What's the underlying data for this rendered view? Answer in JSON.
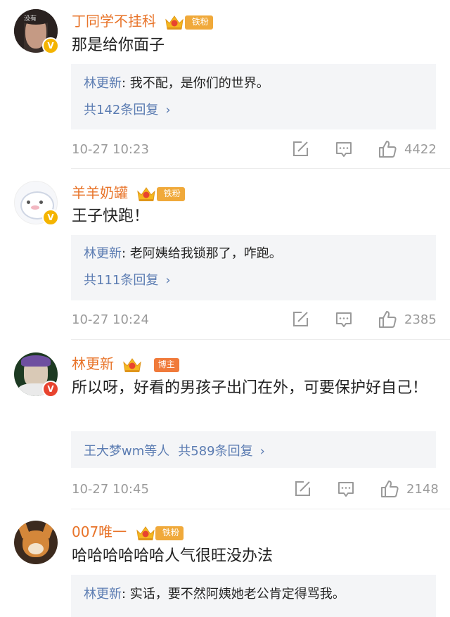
{
  "comments": [
    {
      "user": "丁同学不挂科",
      "badge": "铁粉",
      "text": "那是给你面子",
      "reply": {
        "name": "林更新",
        "sep": ": ",
        "text": "我不配，是你们的世界。"
      },
      "more": "共142条回复",
      "time": "10-27 10:23",
      "likes": "4422"
    },
    {
      "user": "羊羊奶罐",
      "badge": "铁粉",
      "text": "王子快跑！",
      "reply": {
        "name": "林更新",
        "sep": ": ",
        "text": "老阿姨给我锁那了，咋跑。"
      },
      "more": "共111条回复",
      "time": "10-27 10:24",
      "likes": "2385"
    },
    {
      "user": "林更新",
      "badge": "博主",
      "text": "所以呀，好看的男孩子出门在外，可要保护好自己！",
      "reply_prefix": "王大梦wm等人",
      "more": "共589条回复",
      "time": "10-27 10:45",
      "likes": "2148"
    },
    {
      "user": "007唯一",
      "badge": "铁粉",
      "text": "哈哈哈哈哈哈人气很旺没办法",
      "reply": {
        "name": "林更新",
        "sep": ": ",
        "text": "实话，要不然阿姨她老公肯定得骂我。"
      }
    }
  ],
  "avatar1_text": "没有",
  "chevron": "›",
  "colors": {
    "username": "#e8742a",
    "link": "#5b7cb2",
    "meta": "#9a9a9a",
    "replyBg": "#f4f5f7"
  },
  "icons": [
    "edit-icon",
    "comment-icon",
    "like-icon",
    "crown-icon",
    "verified-icon"
  ]
}
